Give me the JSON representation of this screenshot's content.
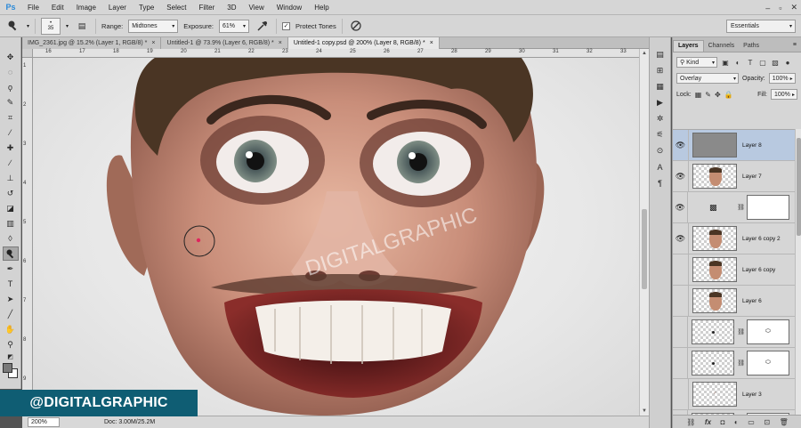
{
  "app": {
    "logo": "Ps",
    "menu": [
      "File",
      "Edit",
      "Image",
      "Layer",
      "Type",
      "Select",
      "Filter",
      "3D",
      "View",
      "Window",
      "Help"
    ]
  },
  "options": {
    "brush_size": "35",
    "range_label": "Range:",
    "range_value": "Midtones",
    "exposure_label": "Exposure:",
    "exposure_value": "61%",
    "protect_tones_label": "Protect Tones",
    "protect_tones_checked": "✓",
    "workspace": "Essentials"
  },
  "tabs": [
    {
      "label": "IMG_2361.jpg @ 15.2% (Layer 1, RGB/8) *"
    },
    {
      "label": "Untitled-1 @ 73.9% (Layer 6, RGB/8) *"
    },
    {
      "label": "Untitled-1 copy.psd @ 200% (Layer 8, RGB/8) *"
    }
  ],
  "ruler": {
    "top": [
      "16",
      "17",
      "18",
      "19",
      "20",
      "21",
      "22",
      "23",
      "24",
      "25",
      "26",
      "27",
      "28",
      "29",
      "30",
      "31",
      "32",
      "33"
    ],
    "left": [
      "1",
      "2",
      "3",
      "4",
      "5",
      "6",
      "7",
      "8",
      "9"
    ]
  },
  "canvas": {
    "watermark": "DIGITALGRAPHIC"
  },
  "banner": "@DIGITALGRAPHIC",
  "status": {
    "zoom": "200%",
    "doc": "Doc: 3.00M/25.2M"
  },
  "layers_panel": {
    "tabs": [
      "Layers",
      "Channels",
      "Paths"
    ],
    "filter_kind": "Kind",
    "blend_mode": "Overlay",
    "opacity_label": "Opacity:",
    "opacity_value": "100%",
    "lock_label": "Lock:",
    "fill_label": "Fill:",
    "fill_value": "100%",
    "layers": [
      {
        "name": "Layer 8",
        "visible": true,
        "selected": true,
        "thumb": "gray"
      },
      {
        "name": "Layer 7",
        "visible": true,
        "selected": false,
        "thumb": "face"
      },
      {
        "name": "",
        "visible": true,
        "selected": false,
        "thumb": "adj"
      },
      {
        "name": "Layer 6 copy 2",
        "visible": true,
        "selected": false,
        "thumb": "face"
      },
      {
        "name": "Layer 6 copy",
        "visible": false,
        "selected": false,
        "thumb": "face"
      },
      {
        "name": "Layer 6",
        "visible": false,
        "selected": false,
        "thumb": "face"
      },
      {
        "name": "",
        "visible": false,
        "selected": false,
        "thumb": "dot"
      },
      {
        "name": "",
        "visible": false,
        "selected": false,
        "thumb": "dot"
      },
      {
        "name": "Layer 3",
        "visible": false,
        "selected": false,
        "thumb": "mark"
      },
      {
        "name": "",
        "visible": false,
        "selected": false,
        "thumb": "mark"
      }
    ]
  },
  "colors": {
    "banner_bg": "#0f5d73",
    "selected_layer": "#b8c9e0",
    "brush_dot": "#e0245e"
  }
}
